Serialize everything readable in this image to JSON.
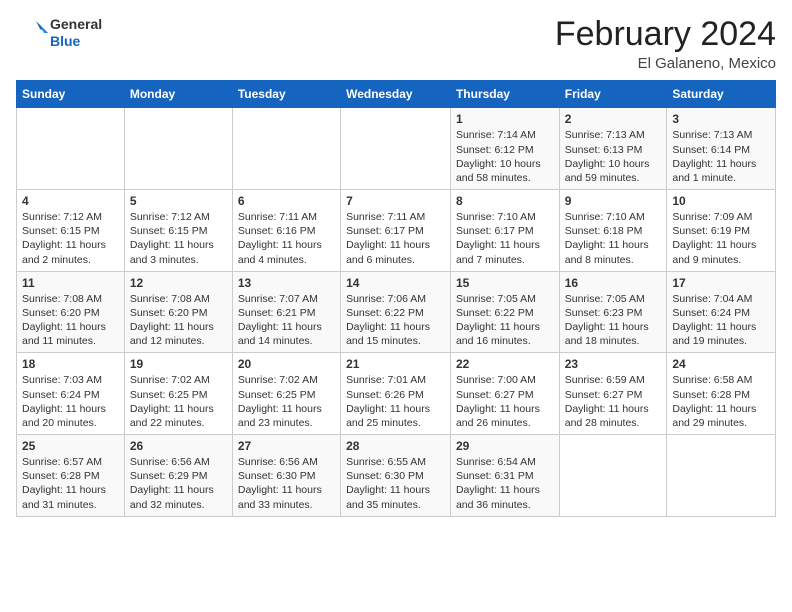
{
  "header": {
    "logo_general": "General",
    "logo_blue": "Blue",
    "month_year": "February 2024",
    "location": "El Galaneno, Mexico"
  },
  "days_of_week": [
    "Sunday",
    "Monday",
    "Tuesday",
    "Wednesday",
    "Thursday",
    "Friday",
    "Saturday"
  ],
  "weeks": [
    [
      {
        "day": "",
        "info": ""
      },
      {
        "day": "",
        "info": ""
      },
      {
        "day": "",
        "info": ""
      },
      {
        "day": "",
        "info": ""
      },
      {
        "day": "1",
        "info": "Sunrise: 7:14 AM\nSunset: 6:12 PM\nDaylight: 10 hours and 58 minutes."
      },
      {
        "day": "2",
        "info": "Sunrise: 7:13 AM\nSunset: 6:13 PM\nDaylight: 10 hours and 59 minutes."
      },
      {
        "day": "3",
        "info": "Sunrise: 7:13 AM\nSunset: 6:14 PM\nDaylight: 11 hours and 1 minute."
      }
    ],
    [
      {
        "day": "4",
        "info": "Sunrise: 7:12 AM\nSunset: 6:15 PM\nDaylight: 11 hours and 2 minutes."
      },
      {
        "day": "5",
        "info": "Sunrise: 7:12 AM\nSunset: 6:15 PM\nDaylight: 11 hours and 3 minutes."
      },
      {
        "day": "6",
        "info": "Sunrise: 7:11 AM\nSunset: 6:16 PM\nDaylight: 11 hours and 4 minutes."
      },
      {
        "day": "7",
        "info": "Sunrise: 7:11 AM\nSunset: 6:17 PM\nDaylight: 11 hours and 6 minutes."
      },
      {
        "day": "8",
        "info": "Sunrise: 7:10 AM\nSunset: 6:17 PM\nDaylight: 11 hours and 7 minutes."
      },
      {
        "day": "9",
        "info": "Sunrise: 7:10 AM\nSunset: 6:18 PM\nDaylight: 11 hours and 8 minutes."
      },
      {
        "day": "10",
        "info": "Sunrise: 7:09 AM\nSunset: 6:19 PM\nDaylight: 11 hours and 9 minutes."
      }
    ],
    [
      {
        "day": "11",
        "info": "Sunrise: 7:08 AM\nSunset: 6:20 PM\nDaylight: 11 hours and 11 minutes."
      },
      {
        "day": "12",
        "info": "Sunrise: 7:08 AM\nSunset: 6:20 PM\nDaylight: 11 hours and 12 minutes."
      },
      {
        "day": "13",
        "info": "Sunrise: 7:07 AM\nSunset: 6:21 PM\nDaylight: 11 hours and 14 minutes."
      },
      {
        "day": "14",
        "info": "Sunrise: 7:06 AM\nSunset: 6:22 PM\nDaylight: 11 hours and 15 minutes."
      },
      {
        "day": "15",
        "info": "Sunrise: 7:05 AM\nSunset: 6:22 PM\nDaylight: 11 hours and 16 minutes."
      },
      {
        "day": "16",
        "info": "Sunrise: 7:05 AM\nSunset: 6:23 PM\nDaylight: 11 hours and 18 minutes."
      },
      {
        "day": "17",
        "info": "Sunrise: 7:04 AM\nSunset: 6:24 PM\nDaylight: 11 hours and 19 minutes."
      }
    ],
    [
      {
        "day": "18",
        "info": "Sunrise: 7:03 AM\nSunset: 6:24 PM\nDaylight: 11 hours and 20 minutes."
      },
      {
        "day": "19",
        "info": "Sunrise: 7:02 AM\nSunset: 6:25 PM\nDaylight: 11 hours and 22 minutes."
      },
      {
        "day": "20",
        "info": "Sunrise: 7:02 AM\nSunset: 6:25 PM\nDaylight: 11 hours and 23 minutes."
      },
      {
        "day": "21",
        "info": "Sunrise: 7:01 AM\nSunset: 6:26 PM\nDaylight: 11 hours and 25 minutes."
      },
      {
        "day": "22",
        "info": "Sunrise: 7:00 AM\nSunset: 6:27 PM\nDaylight: 11 hours and 26 minutes."
      },
      {
        "day": "23",
        "info": "Sunrise: 6:59 AM\nSunset: 6:27 PM\nDaylight: 11 hours and 28 minutes."
      },
      {
        "day": "24",
        "info": "Sunrise: 6:58 AM\nSunset: 6:28 PM\nDaylight: 11 hours and 29 minutes."
      }
    ],
    [
      {
        "day": "25",
        "info": "Sunrise: 6:57 AM\nSunset: 6:28 PM\nDaylight: 11 hours and 31 minutes."
      },
      {
        "day": "26",
        "info": "Sunrise: 6:56 AM\nSunset: 6:29 PM\nDaylight: 11 hours and 32 minutes."
      },
      {
        "day": "27",
        "info": "Sunrise: 6:56 AM\nSunset: 6:30 PM\nDaylight: 11 hours and 33 minutes."
      },
      {
        "day": "28",
        "info": "Sunrise: 6:55 AM\nSunset: 6:30 PM\nDaylight: 11 hours and 35 minutes."
      },
      {
        "day": "29",
        "info": "Sunrise: 6:54 AM\nSunset: 6:31 PM\nDaylight: 11 hours and 36 minutes."
      },
      {
        "day": "",
        "info": ""
      },
      {
        "day": "",
        "info": ""
      }
    ]
  ]
}
